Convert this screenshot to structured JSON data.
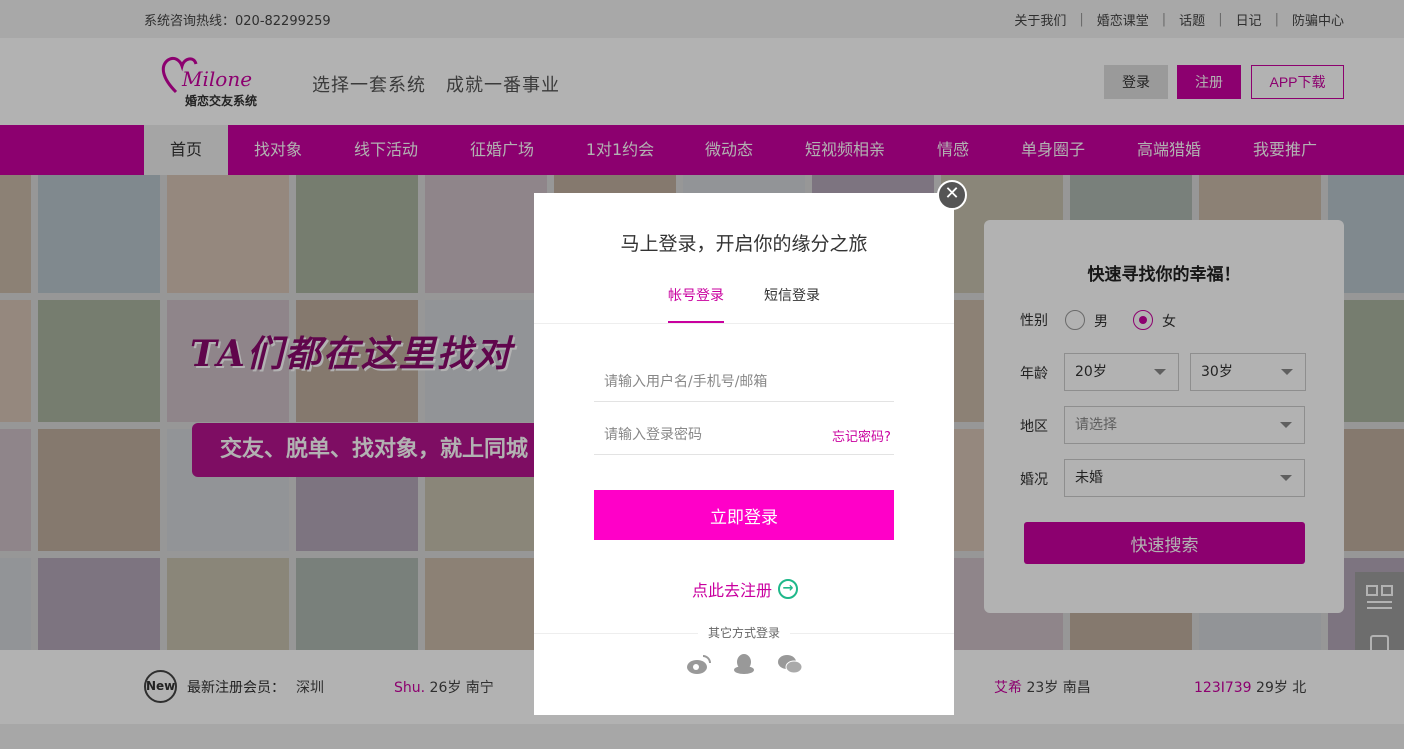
{
  "topbar": {
    "hotline": "系统咨询热线：020-82299259",
    "links": [
      "关于我们",
      "婚恋课堂",
      "话题",
      "日记",
      "防骗中心"
    ]
  },
  "header": {
    "logo_script": "Milone",
    "logo_text": "婚恋交友系统",
    "slogan_1": "选择一套系统",
    "slogan_2": "成就一番事业",
    "login_label": "登录",
    "register_label": "注册",
    "app_label": "APP下载"
  },
  "nav": {
    "items": [
      "首页",
      "找对象",
      "线下活动",
      "征婚广场",
      "1对1约会",
      "微动态",
      "短视频相亲",
      "情感",
      "单身圈子",
      "高端猎婚",
      "我要推广"
    ],
    "active_index": 0
  },
  "hero": {
    "title": "TA们都在这里找对",
    "subtitle": "交友、脱单、找对象，就上同城"
  },
  "quick_search": {
    "title": "快速寻找你的幸福！",
    "gender_label": "性别",
    "gender_options": [
      "男",
      "女"
    ],
    "gender_selected": "女",
    "age_label": "年龄",
    "age_min": "20岁",
    "age_max": "30岁",
    "region_label": "地区",
    "region_placeholder": "请选择",
    "marital_label": "婚况",
    "marital_value": "未婚",
    "search_button": "快速搜索"
  },
  "strip": {
    "badge": "New",
    "label": "最新注册会员：",
    "members": [
      {
        "name": "",
        "info": "深圳"
      },
      {
        "name": "Shu.",
        "info": "26岁 南宁"
      },
      {
        "name": "艾希",
        "info": "23岁 南昌"
      },
      {
        "name": "123I739",
        "info": "29岁 北"
      }
    ]
  },
  "modal": {
    "title": "马上登录，开启你的缘分之旅",
    "tab_account": "帐号登录",
    "tab_sms": "短信登录",
    "username_placeholder": "请输入用户名/手机号/邮箱",
    "password_placeholder": "请输入登录密码",
    "forgot": "忘记密码?",
    "submit": "立即登录",
    "to_register": "点此去注册",
    "other_login": "其它方式登录",
    "social_icons": [
      "weibo-icon",
      "qq-icon",
      "wechat-icon"
    ]
  },
  "colors": {
    "brand": "#c9009f",
    "submit": "#ff00c8",
    "accent_green": "#1fb88a"
  }
}
